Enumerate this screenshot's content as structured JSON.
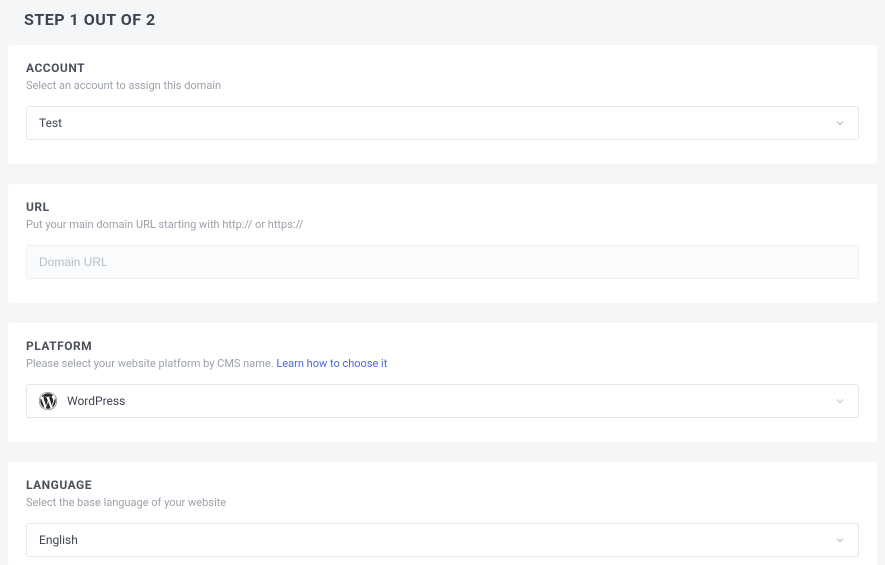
{
  "page_title": "STEP 1 OUT OF 2",
  "account": {
    "title": "ACCOUNT",
    "hint": "Select an account to assign this domain",
    "selected": "Test"
  },
  "url": {
    "title": "URL",
    "hint": "Put your main domain URL starting with http:// or https://",
    "placeholder": "Domain URL",
    "value": ""
  },
  "platform": {
    "title": "PLATFORM",
    "hint_prefix": "Please select your website platform by CMS name. ",
    "hint_link": "Learn how to choose it",
    "selected": "WordPress",
    "icon": "wordpress-icon"
  },
  "language": {
    "title": "LANGUAGE",
    "hint": "Select the base language of your website",
    "selected": "English"
  }
}
